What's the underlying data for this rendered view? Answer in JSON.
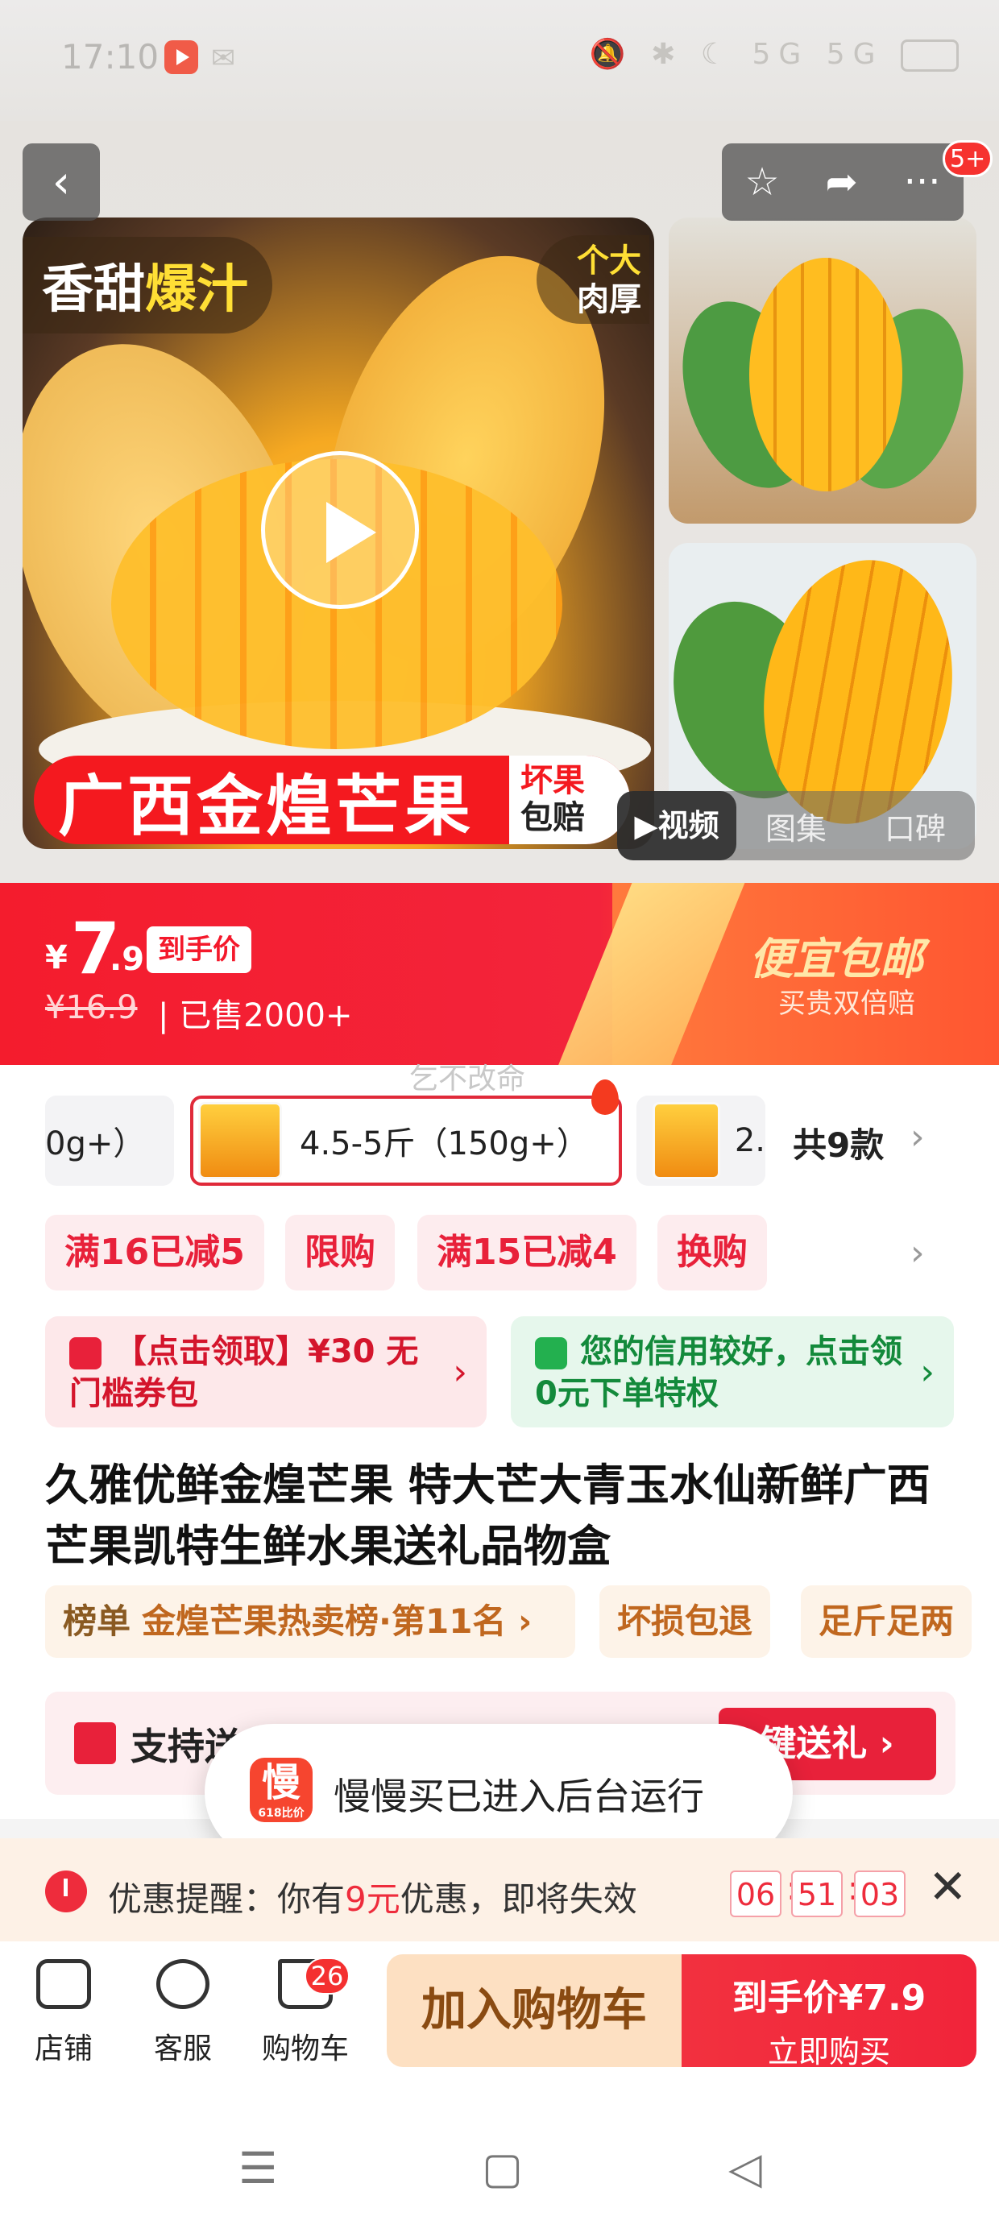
{
  "status_bar": {
    "time": "17:10",
    "right_icons": "🔕 ✱ ☾ 5G 5G"
  },
  "gallery": {
    "back_icon": "‹",
    "star_icon": "☆",
    "share_icon": "➦",
    "more_icon": "···",
    "notif_badge": "5+",
    "main_tag_white": "香甜",
    "main_tag_yellow": "爆汁",
    "corner_tag_1": "个大",
    "corner_tag_2": "肉厚",
    "banner_text": "广西金煌芒果",
    "banner_side_1": "坏果",
    "banner_side_2": "包赔",
    "media_tabs": [
      "▶视频",
      "图集",
      "口碑"
    ]
  },
  "price": {
    "currency": "¥",
    "integer": "7",
    "decimal": ".9",
    "tag": "到手价",
    "original": "¥16.9",
    "sold": "| 已售2000+",
    "promo_title": "便宜包邮",
    "promo_sub": "买贵双倍赔"
  },
  "watermark": "乞不改命",
  "sku": {
    "partial_left": "0g+）",
    "selected": "4.5-5斤（150g+）",
    "partial_right": "2.",
    "count": "共9款"
  },
  "chips": [
    "满16已减5",
    "限购",
    "满15已减4",
    "换购"
  ],
  "coupons": {
    "left": "【点击领取】¥30 无门槛券包",
    "right": "您的信用较好，点击领0元下单特权"
  },
  "product_title": "久雅优鲜金煌芒果 特大芒大青玉水仙新鲜广西芒果凯特生鲜水果送礼品物盒",
  "rank": {
    "label": "榜单",
    "text": "金煌芒果热卖榜·第11名 ›",
    "tag1": "坏损包退",
    "tag2": "足斤足两"
  },
  "gift": {
    "text": "支持送",
    "button": "键送礼 ›"
  },
  "toast": {
    "icon_text": "慢",
    "icon_sub": "618比价",
    "message": "慢慢买已进入后台运行"
  },
  "reminder": {
    "prefix": "优惠提醒：你有",
    "amount": "9元",
    "suffix": "优惠，即将失效",
    "hh": "06",
    "mm": "51",
    "ss": "03",
    "close": "✕"
  },
  "bottom_bar": {
    "store": "店铺",
    "service": "客服",
    "cart": "购物车",
    "cart_count": "26",
    "add_to_cart": "加入购物车",
    "buy_line1": "到手价¥7.9",
    "buy_line2": "立即购买"
  },
  "system_nav": {
    "menu": "☰",
    "home": "▢",
    "back": "◁"
  },
  "colors": {
    "accent_red": "#f41c2d",
    "promo_orange": "#ff5a2d",
    "cart_button": "#fde0c2"
  }
}
